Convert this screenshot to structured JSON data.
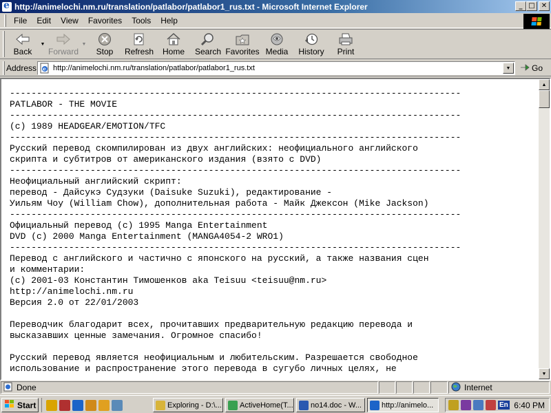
{
  "window": {
    "title": "http://animelochi.nm.ru/translation/patlabor/patlabor1_rus.txt - Microsoft Internet Explorer",
    "minimize": "_",
    "maximize": "□",
    "close": "✕"
  },
  "menu": [
    "File",
    "Edit",
    "View",
    "Favorites",
    "Tools",
    "Help"
  ],
  "toolbar": {
    "back": "Back",
    "forward": "Forward",
    "stop": "Stop",
    "refresh": "Refresh",
    "home": "Home",
    "search": "Search",
    "favorites": "Favorites",
    "media": "Media",
    "history": "History",
    "print": "Print"
  },
  "address": {
    "label": "Address",
    "url": "http://animelochi.nm.ru/translation/patlabor/patlabor1_rus.txt",
    "go": "Go"
  },
  "content": {
    "lines": [
      "------------------------------------------------------------------------------------",
      "PATLABOR - THE MOVIE",
      "------------------------------------------------------------------------------------",
      "(c) 1989 HEADGEAR/EMOTION/TFC",
      "------------------------------------------------------------------------------------",
      "Русский перевод скомпилирован из двух английских: неофициального английского",
      "скрипта и субтитров от американского издания (взято с DVD)",
      "------------------------------------------------------------------------------------",
      "Неофициальный английский скрипт:",
      "перевод - Дайсукэ Судзуки (Daisuke Suzuki), редактирование -",
      "Уильям Чоу (William Chow), дополнительная работа - Майк Джексон (Mike Jackson)",
      "------------------------------------------------------------------------------------",
      "Официальный перевод (c) 1995 Manga Entertainment",
      "DVD (c) 2000 Manga Entertainment (MANGA4054-2 WRO1)",
      "------------------------------------------------------------------------------------",
      "Перевод с английского и частично с японского на русский, а также названия сцен",
      "и комментарии:",
      "(c) 2001-03 Константин Тимошенков aka Teisuu <teisuu@nm.ru>",
      "http://animelochi.nm.ru",
      "Версия 2.0 от 22/01/2003",
      "",
      "Переводчик благодарит всех, прочитавших предварительную редакцию перевода и",
      "высказавших ценные замечания. Огромное спасибо!",
      "",
      "Русский перевод является неофициальным и любительским. Разрешается свободное",
      "использование и распространение этого перевода в сугубо личных целях, не"
    ]
  },
  "status": {
    "text": "Done",
    "zone": "Internet"
  },
  "taskbar": {
    "start": "Start",
    "tasks": [
      "Exploring - D:\\...",
      "ActiveHome(T...",
      "no14.doc - W...",
      "http://animelo..."
    ],
    "lang": "En",
    "clock": "6:40 PM"
  },
  "icons": {
    "back": "back-arrow-icon",
    "forward": "forward-arrow-icon",
    "stop": "stop-icon",
    "refresh": "refresh-icon",
    "home": "home-icon",
    "search": "search-icon",
    "favorites": "favorites-icon",
    "media": "media-icon",
    "history": "history-icon",
    "print": "print-icon"
  }
}
